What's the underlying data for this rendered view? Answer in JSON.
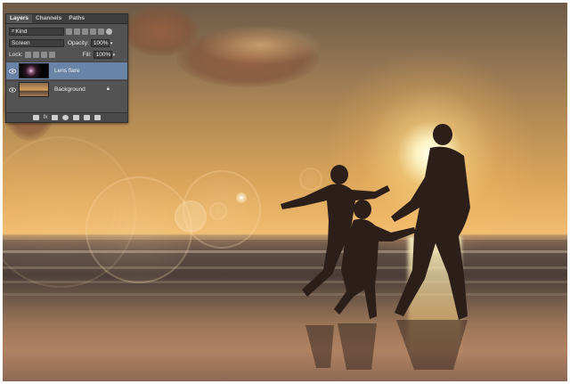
{
  "panel": {
    "tabs": [
      "Layers",
      "Channels",
      "Paths"
    ],
    "filter_label": "Kind",
    "blend_mode": "Screen",
    "opacity_label": "Opacity:",
    "opacity_value": "100%",
    "lock_label": "Lock:",
    "fill_label": "Fill:",
    "fill_value": "100%",
    "layers": [
      {
        "name": "Lens flare",
        "selected": true
      },
      {
        "name": "Background",
        "selected": false
      }
    ],
    "bottom_icons": [
      "link-icon",
      "fx-icon",
      "mask-icon",
      "adjustment-icon",
      "folder-icon",
      "new-layer-icon",
      "trash-icon"
    ]
  },
  "colors": {
    "panel_bg": "#535353",
    "selected_layer": "#6a84a8",
    "sky_top": "#6e5a47",
    "sun": "#fff8c8"
  }
}
